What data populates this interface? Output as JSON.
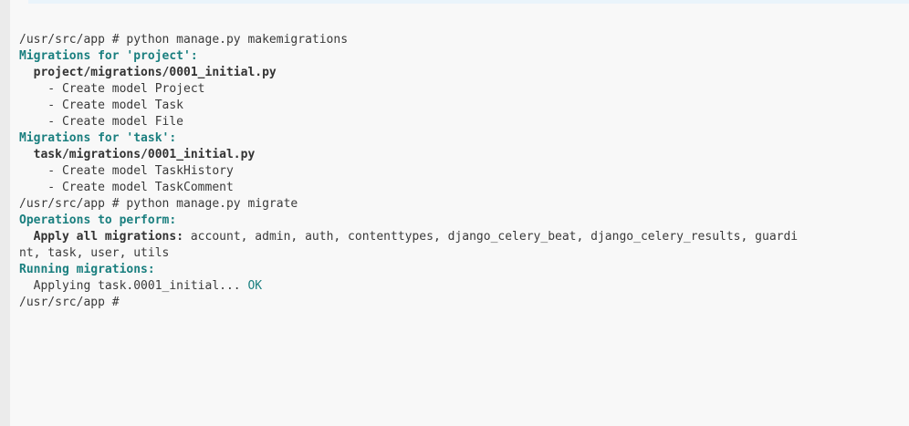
{
  "terminal": {
    "lines": [
      {
        "segments": [
          {
            "text": "/usr/src/app # python manage.py makemigrations",
            "style": "normal"
          }
        ]
      },
      {
        "segments": [
          {
            "text": "Migrations for 'project':",
            "style": "hl"
          }
        ]
      },
      {
        "segments": [
          {
            "text": "  ",
            "style": "normal"
          },
          {
            "text": "project/migrations/0001_initial.py",
            "style": "bold"
          }
        ]
      },
      {
        "segments": [
          {
            "text": "    - Create model Project",
            "style": "normal"
          }
        ]
      },
      {
        "segments": [
          {
            "text": "    - Create model Task",
            "style": "normal"
          }
        ]
      },
      {
        "segments": [
          {
            "text": "    - Create model File",
            "style": "normal"
          }
        ]
      },
      {
        "segments": [
          {
            "text": "Migrations for 'task':",
            "style": "hl"
          }
        ]
      },
      {
        "segments": [
          {
            "text": "  ",
            "style": "normal"
          },
          {
            "text": "task/migrations/0001_initial.py",
            "style": "bold"
          }
        ]
      },
      {
        "segments": [
          {
            "text": "    - Create model TaskHistory",
            "style": "normal"
          }
        ]
      },
      {
        "segments": [
          {
            "text": "    - Create model TaskComment",
            "style": "normal"
          }
        ]
      },
      {
        "segments": [
          {
            "text": "/usr/src/app # python manage.py migrate",
            "style": "normal"
          }
        ]
      },
      {
        "segments": [
          {
            "text": "Operations to perform:",
            "style": "hl"
          }
        ]
      },
      {
        "segments": [
          {
            "text": "  ",
            "style": "normal"
          },
          {
            "text": "Apply all migrations:",
            "style": "bold"
          },
          {
            "text": " account, admin, auth, contenttypes, django_celery_beat, django_celery_results, guardi",
            "style": "normal"
          }
        ]
      },
      {
        "segments": [
          {
            "text": "nt, task, user, utils",
            "style": "normal"
          }
        ]
      },
      {
        "segments": [
          {
            "text": "Running migrations:",
            "style": "hl"
          }
        ]
      },
      {
        "segments": [
          {
            "text": "  Applying task.0001_initial...",
            "style": "normal"
          },
          {
            "text": " OK",
            "style": "ok"
          }
        ]
      },
      {
        "segments": [
          {
            "text": "/usr/src/app #",
            "style": "normal"
          }
        ]
      }
    ]
  }
}
